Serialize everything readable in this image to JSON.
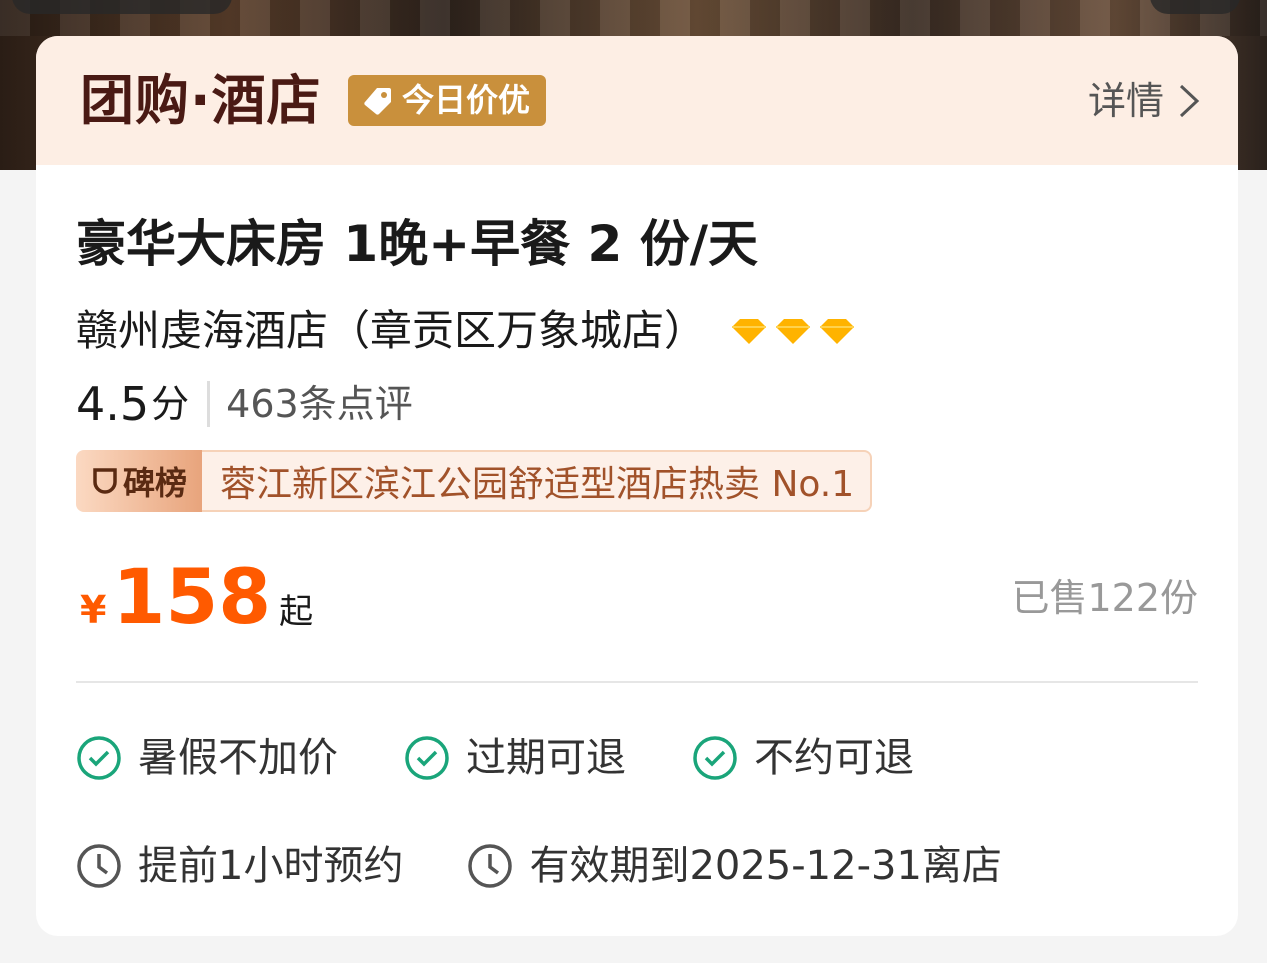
{
  "header": {
    "brand_title": "团购·酒店",
    "deal_badge": "今日价优",
    "detail_link": "详情",
    "icons": {
      "tag": "tag-icon",
      "chevron": "chevron-right-icon"
    }
  },
  "room": {
    "title": "豪华大床房 1晚+早餐 2 份/天"
  },
  "hotel": {
    "name": "赣州虔海酒店（章贡区万象城店）",
    "diamond_count": 3,
    "diamond_color": "#ffb300"
  },
  "rating": {
    "score": "4.5",
    "score_unit": "分",
    "reviews": "463条点评"
  },
  "ranking": {
    "tag_label": "碑榜",
    "text": "蓉江新区滨江公园舒适型酒店热卖 No.1"
  },
  "price": {
    "symbol": "¥",
    "value": "158",
    "suffix": "起",
    "color": "#ff5a00"
  },
  "sold": "已售122份",
  "features": [
    {
      "label": "暑假不加价",
      "icon": "check-circle-icon"
    },
    {
      "label": "过期可退",
      "icon": "check-circle-icon"
    },
    {
      "label": "不约可退",
      "icon": "check-circle-icon"
    }
  ],
  "info": [
    {
      "label": "提前1小时预约",
      "icon": "clock-icon"
    },
    {
      "label": "有效期到2025-12-31离店",
      "icon": "clock-icon"
    }
  ],
  "colors": {
    "header_bg": "#fdeee4",
    "badge_bg": "#c9903c",
    "check_green": "#1aa57a"
  }
}
